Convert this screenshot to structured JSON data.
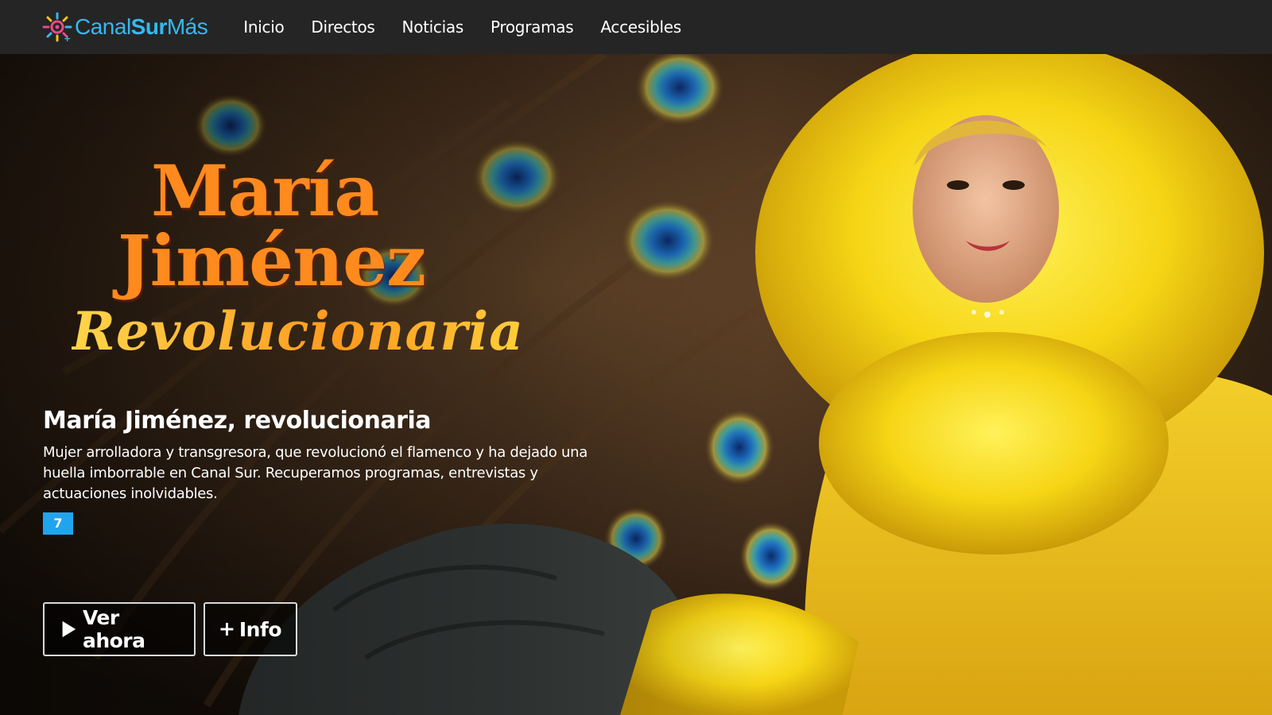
{
  "brand": {
    "name_part1": "Canal",
    "name_part2": "Sur",
    "name_part3": "Más"
  },
  "nav": {
    "items": [
      {
        "label": "Inicio"
      },
      {
        "label": "Directos"
      },
      {
        "label": "Noticias"
      },
      {
        "label": "Programas"
      },
      {
        "label": "Accesibles"
      }
    ]
  },
  "hero": {
    "logo_lines": [
      "María",
      "Jiménez",
      "Revolucionaria"
    ],
    "title": "María Jiménez, revolucionaria",
    "description": "Mujer arrolladora y transgresora, que revolucionó el flamenco y ha dejado una huella imborrable en Canal Sur. Recuperamos programas, entrevistas y actuaciones inolvidables.",
    "age_rating": "7",
    "buttons": {
      "watch": {
        "label": "Ver ahora",
        "icon": "play-icon"
      },
      "info": {
        "label": "Info",
        "icon": "plus-icon"
      }
    }
  },
  "colors": {
    "topbar": "#252525",
    "brand_blue": "#35b9f0",
    "title_orange": "#ff8a1e",
    "rating_blue": "#1ea5ee",
    "costume_yellow": "#f5d41a"
  }
}
